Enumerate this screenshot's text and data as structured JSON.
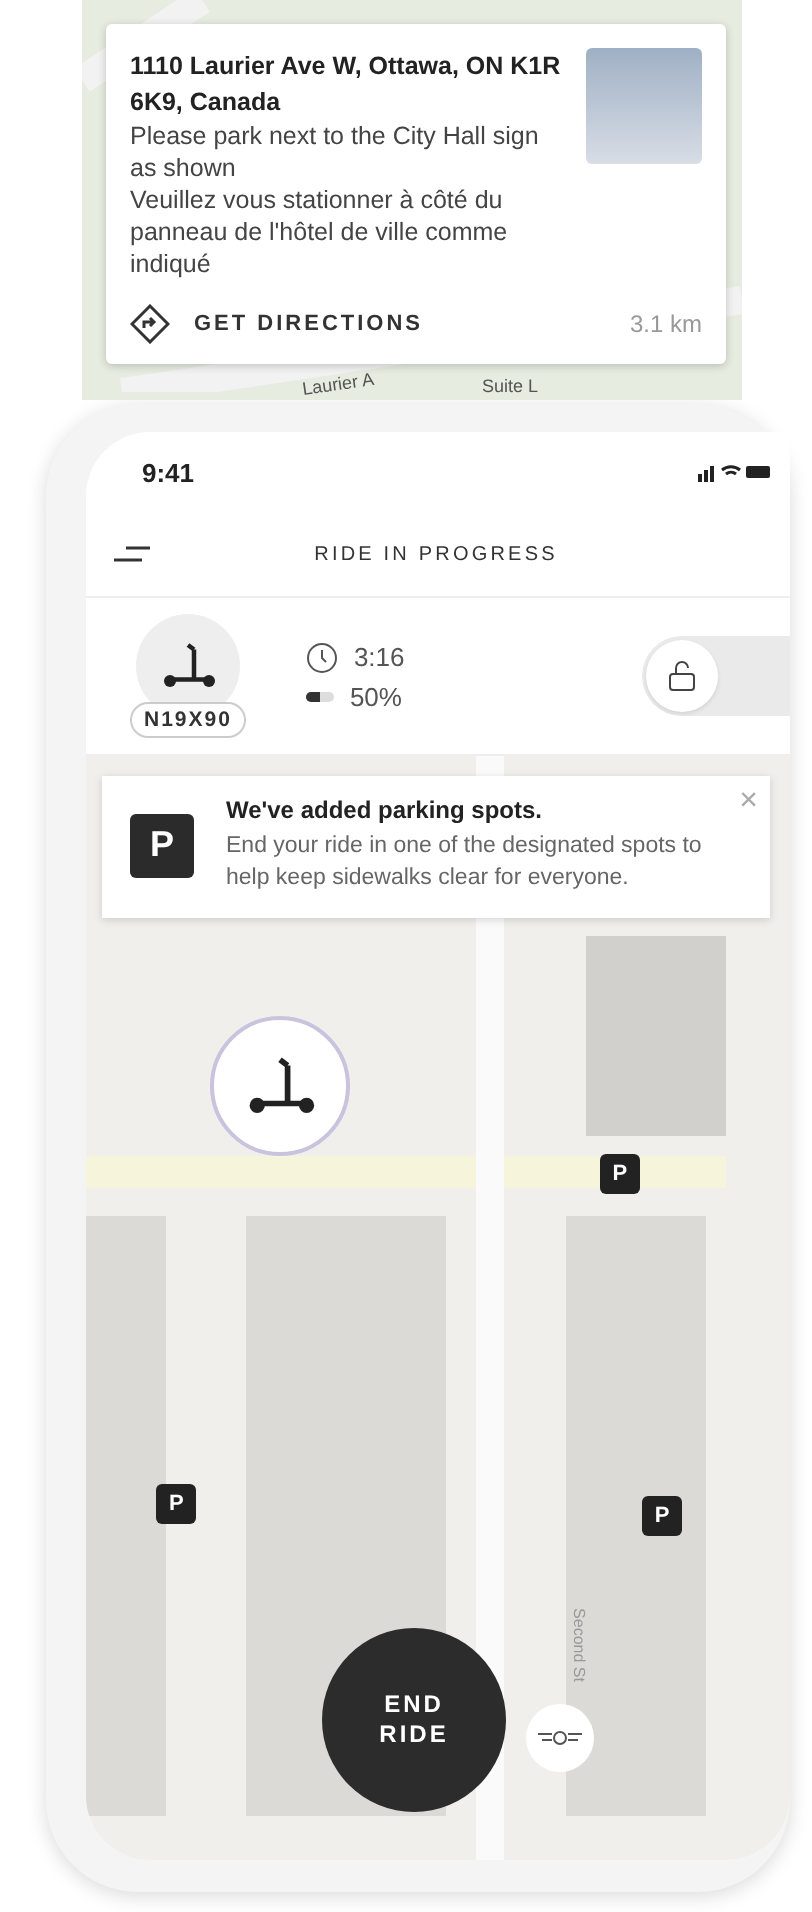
{
  "location_card": {
    "address": "1110 Laurier Ave W, Ottawa, ON K1R 6K9, Canada",
    "instructions": "Please park next to the City Hall sign as shown",
    "instructions_fr": "Veuillez vous stationner à côté du panneau de l'hôtel de ville comme indiqué",
    "action": "GET DIRECTIONS",
    "distance": "3.1 km"
  },
  "top_map": {
    "street_labels": [
      "Laurier A",
      "Suite L"
    ]
  },
  "status_bar": {
    "time": "9:41"
  },
  "header": {
    "title": "RIDE IN PROGRESS"
  },
  "ride": {
    "vehicle_id": "N19X90",
    "lock_toggle": {
      "on": false
    },
    "duration": "3:16",
    "battery": {
      "level": 0.5,
      "reading": "50%"
    }
  },
  "notice": {
    "title": "We've added parking spots.",
    "body": "End your ride in one of the designated spots to help keep sidewalks clear for everyone.",
    "badge": "P",
    "close": "×"
  },
  "map": {
    "street_label": "Second St",
    "parking_pins": [
      {
        "label": "P"
      },
      {
        "label": "P"
      },
      {
        "label": "P"
      }
    ]
  },
  "end_button": {
    "label": "END RIDE"
  }
}
